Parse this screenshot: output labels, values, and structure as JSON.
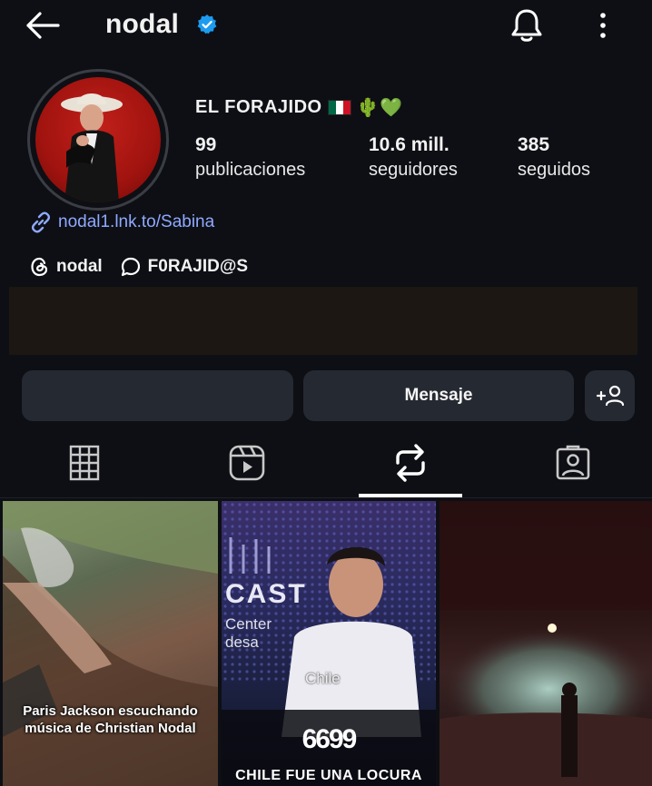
{
  "header": {
    "username": "nodal",
    "back_icon": "arrow-left-icon",
    "verified_icon": "verified-badge-icon",
    "bell_icon": "bell-icon",
    "more_icon": "more-vertical-icon"
  },
  "profile": {
    "display_name": "EL FORAJIDO",
    "name_emojis": "🌵💚",
    "stats": [
      {
        "value": "99",
        "label": "publicaciones"
      },
      {
        "value": "10.6 mill.",
        "label": "seguidores"
      },
      {
        "value": "385",
        "label": "seguidos"
      }
    ],
    "link": "nodal1.lnk.to/Sabina",
    "badges": [
      {
        "label": "nodal",
        "icon": "threads-icon"
      },
      {
        "label": "F0RAJID@S",
        "icon": "channel-icon"
      }
    ]
  },
  "actions": {
    "follow_label": "",
    "message_label": "Mensaje",
    "suggest_icon": "add-person-icon",
    "suggest_label": "+"
  },
  "tabs": [
    {
      "name": "grid",
      "icon": "grid-icon"
    },
    {
      "name": "reels",
      "icon": "reels-icon"
    },
    {
      "name": "reposts",
      "icon": "repost-icon",
      "active": true
    },
    {
      "name": "tagged",
      "icon": "tagged-icon"
    }
  ],
  "posts": [
    {
      "caption": "Paris Jackson escuchando música de Christian Nodal"
    },
    {
      "overlay_cast": "CAST",
      "overlay_center": "Center",
      "overlay_desa": "desa",
      "overlay_chile": "Chile",
      "quote_mark": "6699",
      "caption": "CHILE FUE UNA LOCURA"
    },
    {
      "caption": ""
    }
  ],
  "colors": {
    "background": "#0d0f14",
    "button": "#252932",
    "link": "#8fa9ff",
    "verified": "#1d9bf0"
  }
}
